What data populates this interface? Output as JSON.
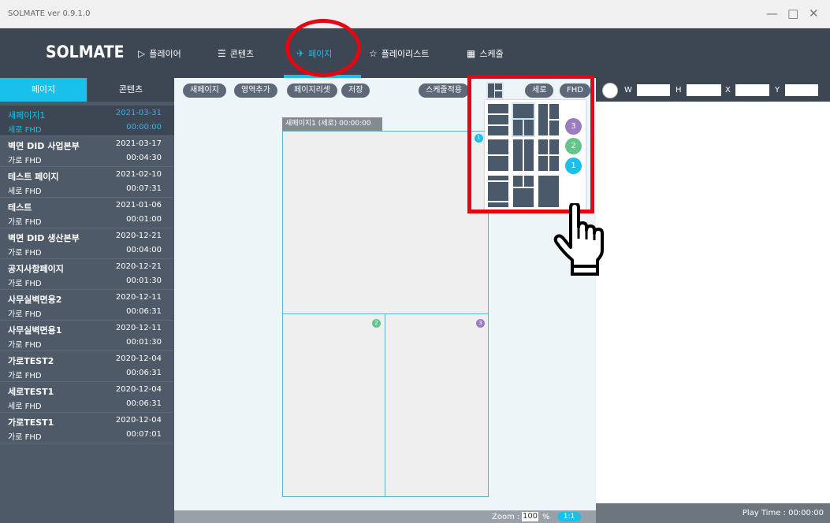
{
  "window": {
    "title": "SOLMATE  ver 0.9.1.0",
    "minimize": "—",
    "maximize": "□",
    "close": "✕"
  },
  "nav": {
    "logo": "SOLMATE",
    "items": [
      {
        "label": "플레이어",
        "icon": "▷"
      },
      {
        "label": "콘텐츠",
        "icon": "☰"
      },
      {
        "label": "페이지",
        "icon": "✈"
      },
      {
        "label": "플레이리스트",
        "icon": "☆"
      },
      {
        "label": "스케줄",
        "icon": "▦"
      }
    ]
  },
  "sidebar": {
    "tabs": [
      "페이지",
      "콘텐츠"
    ],
    "items": [
      {
        "name": "새페이지1",
        "date": "2021-03-31",
        "orient": "세로  FHD",
        "time": "00:00:00"
      },
      {
        "name": "벽면 DID 사업본부",
        "date": "2021-03-17",
        "orient": "가로  FHD",
        "time": "00:04:30"
      },
      {
        "name": "테스트 페이지",
        "date": "2021-02-10",
        "orient": "세로  FHD",
        "time": "00:07:31"
      },
      {
        "name": "테스트",
        "date": "2021-01-06",
        "orient": "가로  FHD",
        "time": "00:01:00"
      },
      {
        "name": "벽면 DID 생산본부",
        "date": "2020-12-21",
        "orient": "가로  FHD",
        "time": "00:04:00"
      },
      {
        "name": "공지사항페이지",
        "date": "2020-12-21",
        "orient": "가로  FHD",
        "time": "00:01:30"
      },
      {
        "name": "사무실벽면용2",
        "date": "2020-12-11",
        "orient": "가로  FHD",
        "time": "00:06:31"
      },
      {
        "name": "사무실벽면용1",
        "date": "2020-12-11",
        "orient": "가로  FHD",
        "time": "00:01:30"
      },
      {
        "name": "가로TEST2",
        "date": "2020-12-04",
        "orient": "가로  FHD",
        "time": "00:06:31"
      },
      {
        "name": "세로TEST1",
        "date": "2020-12-04",
        "orient": "세로  FHD",
        "time": "00:06:31"
      },
      {
        "name": "가로TEST1",
        "date": "2020-12-04",
        "orient": "가로  FHD",
        "time": "00:07:01"
      }
    ]
  },
  "toolbar": {
    "new_page": "새페이지",
    "add_region": "영역추가",
    "reset": "페이지리셋",
    "save": "저장",
    "apply_schedule": "스케줄적용",
    "orientation": "세로",
    "resolution": "FHD"
  },
  "coords": {
    "w": "W",
    "h": "H",
    "x": "X",
    "y": "Y"
  },
  "canvas": {
    "label": "새페이지1 (세로)   00:00:00",
    "badges": [
      "1",
      "2",
      "3"
    ]
  },
  "layout_picker": {
    "badges": [
      "3",
      "2",
      "1"
    ]
  },
  "footer": {
    "zoom_label": "Zoom :",
    "zoom_value": "100",
    "zoom_unit": "%",
    "ratio_button": "1:1",
    "play_time": "Play Time : 00:00:00"
  },
  "colors": {
    "accent": "#19c0ea",
    "badge1": "#19c0ea",
    "badge2": "#62c68c",
    "badge3": "#9b7cc0",
    "highlight": "#e30613"
  }
}
